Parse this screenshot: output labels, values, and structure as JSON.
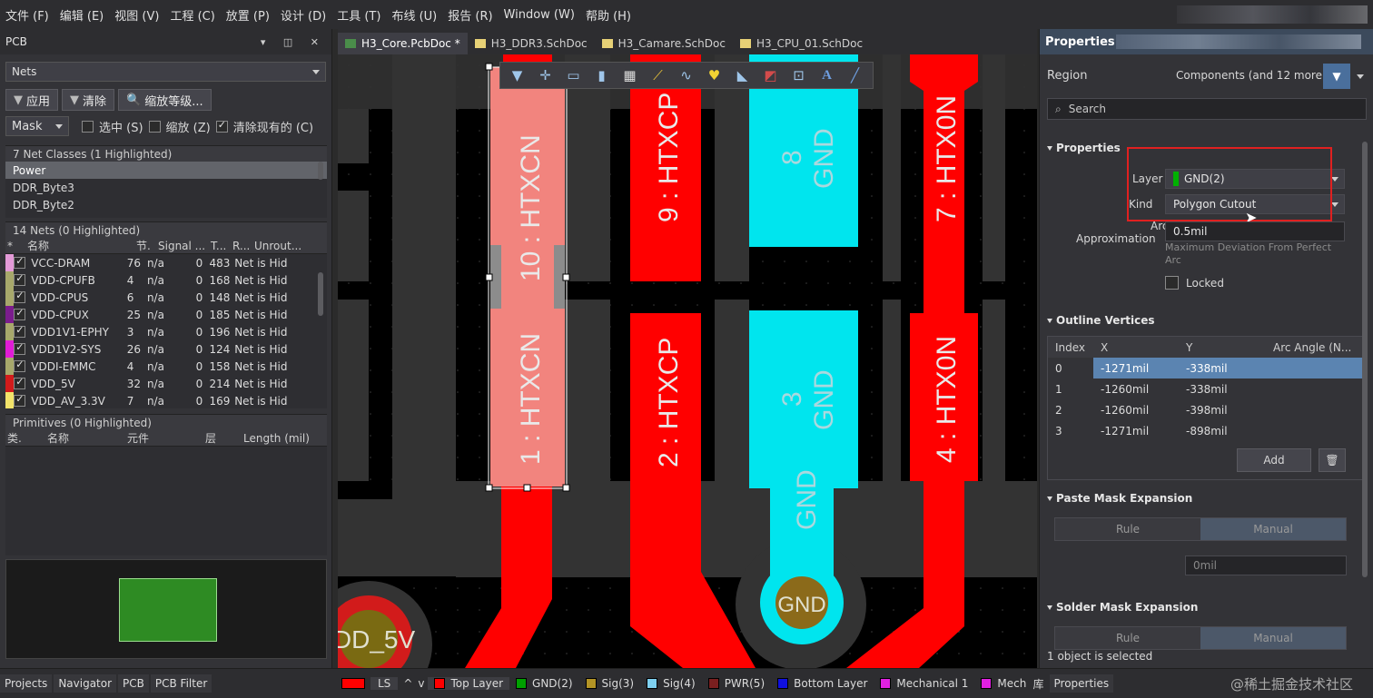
{
  "menu": [
    "文件 (F)",
    "编辑 (E)",
    "视图 (V)",
    "工程 (C)",
    "放置 (P)",
    "设计 (D)",
    "工具 (T)",
    "布线 (U)",
    "报告 (R)",
    "Window (W)",
    "帮助 (H)"
  ],
  "left_panel": {
    "title": "PCB",
    "mode_select": "Nets",
    "buttons": {
      "apply": "应用",
      "clear": "清除",
      "zoom_level": "缩放等级..."
    },
    "mask_select": "Mask",
    "checks": [
      {
        "label": "选中 (S)",
        "checked": false
      },
      {
        "label": "缩放 (Z)",
        "checked": false
      },
      {
        "label": "清除现有的 (C)",
        "checked": true
      }
    ],
    "net_classes_header": "7 Net Classes (1 Highlighted)",
    "net_classes": [
      "Power",
      "DDR_Byte3",
      "DDR_Byte2"
    ],
    "nets_header": "14 Nets (0 Highlighted)",
    "nets_columns": [
      "*",
      "名称",
      "节.",
      "Signal ...",
      "T...",
      "R...",
      "Unrout..."
    ],
    "nets": [
      {
        "color": "#e39ad7",
        "name": "VCC-DRAM",
        "nodes": "76",
        "signal": "n/a",
        "t": "0",
        "routed": "483",
        "unrouted": "Net is Hid"
      },
      {
        "color": "#a7a86b",
        "name": "VDD-CPUFB",
        "nodes": "4",
        "signal": "n/a",
        "t": "0",
        "routed": "168",
        "unrouted": "Net is Hid"
      },
      {
        "color": "#a7a86b",
        "name": "VDD-CPUS",
        "nodes": "6",
        "signal": "n/a",
        "t": "0",
        "routed": "148",
        "unrouted": "Net is Hid"
      },
      {
        "color": "#7b1d8d",
        "name": "VDD-CPUX",
        "nodes": "25",
        "signal": "n/a",
        "t": "0",
        "routed": "185",
        "unrouted": "Net is Hid"
      },
      {
        "color": "#a7a86b",
        "name": "VDD1V1-EPHY",
        "nodes": "3",
        "signal": "n/a",
        "t": "0",
        "routed": "196",
        "unrouted": "Net is Hid"
      },
      {
        "color": "#e01cd6",
        "name": "VDD1V2-SYS",
        "nodes": "26",
        "signal": "n/a",
        "t": "0",
        "routed": "124",
        "unrouted": "Net is Hid"
      },
      {
        "color": "#a7a86b",
        "name": "VDDI-EMMC",
        "nodes": "4",
        "signal": "n/a",
        "t": "0",
        "routed": "158",
        "unrouted": "Net is Hid"
      },
      {
        "color": "#d21b1b",
        "name": "VDD_5V",
        "nodes": "32",
        "signal": "n/a",
        "t": "0",
        "routed": "214",
        "unrouted": "Net is Hid"
      },
      {
        "color": "#f2e36a",
        "name": "VDD_AV_3.3V",
        "nodes": "7",
        "signal": "n/a",
        "t": "0",
        "routed": "169",
        "unrouted": "Net is Hid"
      }
    ],
    "primitives_header": "Primitives (0 Highlighted)",
    "primitives_columns": [
      "类.",
      "名称",
      "元件",
      "层",
      "Length (mil)"
    ]
  },
  "doc_tabs": [
    {
      "label": "H3_Core.PcbDoc *",
      "kind": "pcb",
      "active": true
    },
    {
      "label": "H3_DDR3.SchDoc",
      "kind": "sch",
      "active": false
    },
    {
      "label": "H3_Camare.SchDoc",
      "kind": "sch",
      "active": false
    },
    {
      "label": "H3_CPU_01.SchDoc",
      "kind": "sch",
      "active": false
    }
  ],
  "pads": {
    "p10": "10 : HTXCN",
    "p1": "1 : HTXCN",
    "p9": "9 : HTXCP",
    "p2": "2 : HTXCP",
    "p8": "8\nGND",
    "p8a": "8",
    "p8b": "GND",
    "p3a": "3",
    "p3b": "GND",
    "p7": "7 : HTX0N",
    "p4": "4 : HTX0N",
    "gnd_trace": "GND",
    "gnd_via": "GND",
    "vdd_via": "DD_5V"
  },
  "properties": {
    "title": "Properties",
    "region_label": "Region",
    "region_value": "Components (and 12 more)",
    "search_placeholder": "Search",
    "section_properties": "Properties",
    "layer_label": "Layer",
    "layer_value": "GND(2)",
    "kind_label": "Kind",
    "kind_value": "Polygon Cutout",
    "arc_label_1": "Arc",
    "arc_label_2": "Approximation",
    "arc_value": "0.5mil",
    "arc_hint": "Maximum Deviation From Perfect Arc",
    "locked_label": "Locked",
    "section_outline": "Outline Vertices",
    "vertex_columns": [
      "Index",
      "X",
      "Y",
      "Arc Angle (N..."
    ],
    "vertices": [
      {
        "i": "0",
        "x": "-1271mil",
        "y": "-338mil",
        "a": ""
      },
      {
        "i": "1",
        "x": "-1260mil",
        "y": "-338mil",
        "a": ""
      },
      {
        "i": "2",
        "x": "-1260mil",
        "y": "-398mil",
        "a": ""
      },
      {
        "i": "3",
        "x": "-1271mil",
        "y": "-898mil",
        "a": ""
      }
    ],
    "add_button": "Add",
    "section_paste": "Paste Mask Expansion",
    "paste_rule": "Rule",
    "paste_manual": "Manual",
    "paste_value": "0mil",
    "section_solder": "Solder Mask Expansion",
    "solder_rule": "Rule",
    "solder_manual": "Manual",
    "status": "1 object is selected"
  },
  "bottom": {
    "left_tabs": [
      "Projects",
      "Navigator",
      "PCB",
      "PCB Filter"
    ],
    "ls": "LS",
    "layers": [
      {
        "label": "Top Layer",
        "color": "#ff0000",
        "active": true
      },
      {
        "label": "GND(2)",
        "color": "#00a000",
        "active": false
      },
      {
        "label": "Sig(3)",
        "color": "#b39425",
        "active": false
      },
      {
        "label": "Sig(4)",
        "color": "#7ed0f0",
        "active": false
      },
      {
        "label": "PWR(5)",
        "color": "#7a1f1f",
        "active": false
      },
      {
        "label": "Bottom Layer",
        "color": "#1010e0",
        "active": false
      },
      {
        "label": "Mechanical 1",
        "color": "#e020e0",
        "active": false
      },
      {
        "label": "Mechanic",
        "color": "#e020e0",
        "active": false
      }
    ],
    "lib_tab": "库",
    "props_tab": "Properties",
    "watermark": "@稀土掘金技术社区"
  },
  "colors": {
    "accent": "#3c4a5c",
    "top_layer": "#ff0000",
    "pad_selected": "#f2847e",
    "sig4": "#00e5ee",
    "via": "#8b6a1a",
    "highlight_box": "#e02020"
  }
}
